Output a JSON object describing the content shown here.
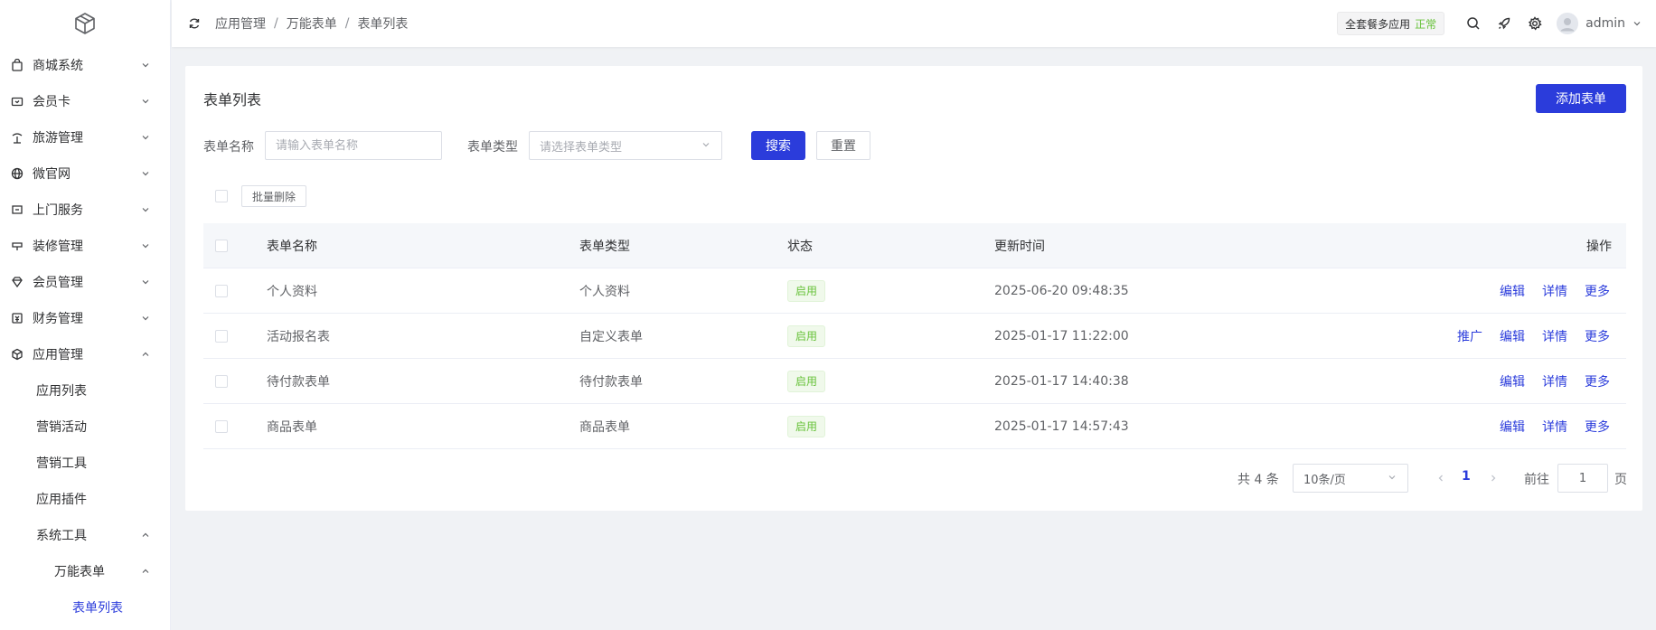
{
  "sidebar": {
    "items": [
      {
        "label": "商城系统",
        "icon": "bag-icon",
        "expanded": false
      },
      {
        "label": "会员卡",
        "icon": "card-icon",
        "expanded": false
      },
      {
        "label": "旅游管理",
        "icon": "palm-icon",
        "expanded": false
      },
      {
        "label": "微官网",
        "icon": "globe-icon",
        "expanded": false
      },
      {
        "label": "上门服务",
        "icon": "service-icon",
        "expanded": false
      },
      {
        "label": "装修管理",
        "icon": "paint-icon",
        "expanded": false
      },
      {
        "label": "会员管理",
        "icon": "diamond-icon",
        "expanded": false
      },
      {
        "label": "财务管理",
        "icon": "finance-icon",
        "expanded": false
      },
      {
        "label": "应用管理",
        "icon": "cube-icon",
        "expanded": true
      }
    ],
    "app_sub": [
      "应用列表",
      "营销活动",
      "营销工具",
      "应用插件"
    ],
    "sys_tools": "系统工具",
    "form_group": "万能表单",
    "form_list": "表单列表"
  },
  "header": {
    "breadcrumb": [
      "应用管理",
      "万能表单",
      "表单列表"
    ],
    "separator": "/",
    "plan_label": "全套餐多应用",
    "plan_status": "正常",
    "username": "admin"
  },
  "page": {
    "title": "表单列表",
    "add_button": "添加表单",
    "filters": {
      "name_label": "表单名称",
      "name_placeholder": "请输入表单名称",
      "type_label": "表单类型",
      "type_placeholder": "请选择表单类型"
    },
    "search_button": "搜索",
    "reset_button": "重置",
    "batch_delete": "批量删除"
  },
  "table": {
    "columns": [
      "表单名称",
      "表单类型",
      "状态",
      "更新时间",
      "操作"
    ],
    "rows": [
      {
        "name": "个人资料",
        "type": "个人资料",
        "status": "启用",
        "updated": "2025-06-20 09:48:35",
        "ops": [
          "编辑",
          "详情",
          "更多"
        ]
      },
      {
        "name": "活动报名表",
        "type": "自定义表单",
        "status": "启用",
        "updated": "2025-01-17 11:22:00",
        "ops": [
          "推广",
          "编辑",
          "详情",
          "更多"
        ]
      },
      {
        "name": "待付款表单",
        "type": "待付款表单",
        "status": "启用",
        "updated": "2025-01-17 14:40:38",
        "ops": [
          "编辑",
          "详情",
          "更多"
        ]
      },
      {
        "name": "商品表单",
        "type": "商品表单",
        "status": "启用",
        "updated": "2025-01-17 14:57:43",
        "ops": [
          "编辑",
          "详情",
          "更多"
        ]
      }
    ]
  },
  "pagination": {
    "total": "共 4 条",
    "page_size": "10条/页",
    "current": "1",
    "goto_label": "前往",
    "goto_value": "1",
    "page_suffix": "页"
  },
  "colors": {
    "primary": "#2b3cdb",
    "success": "#67c23a",
    "background": "#f0f2f5"
  }
}
